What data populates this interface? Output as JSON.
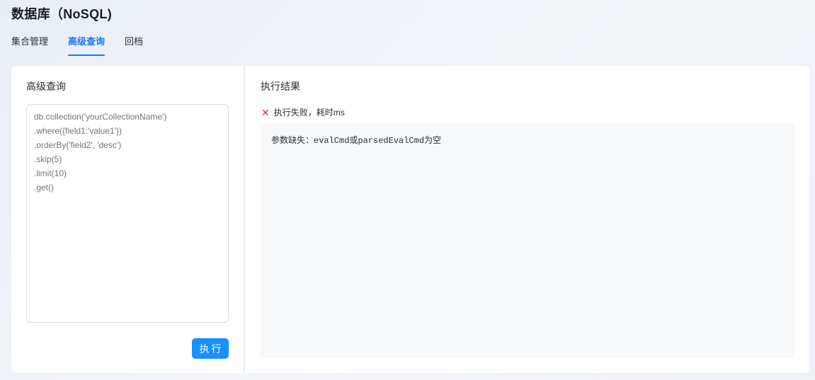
{
  "page_title": "数据库（NoSQL)",
  "tabs": [
    {
      "label": "集合管理",
      "active": false
    },
    {
      "label": "高级查询",
      "active": true
    },
    {
      "label": "回档",
      "active": false
    }
  ],
  "query_panel": {
    "title": "高级查询",
    "placeholder": "db.collection('yourCollectionName')\n.where({field1:'value1'})\n.orderBy('field2', 'desc')\n.skip(5)\n.limit(10)\n.get()",
    "value": "",
    "execute_label": "执行"
  },
  "result_panel": {
    "title": "执行结果",
    "status_icon": "close-icon",
    "status_text": "执行失败，耗时ms",
    "status_color": "#f5222d",
    "result_text": "参数缺失：evalCmd或parsedEvalCmd为空"
  },
  "colors": {
    "accent": "#1677ff",
    "button": "#1890ff",
    "error": "#f5222d"
  }
}
